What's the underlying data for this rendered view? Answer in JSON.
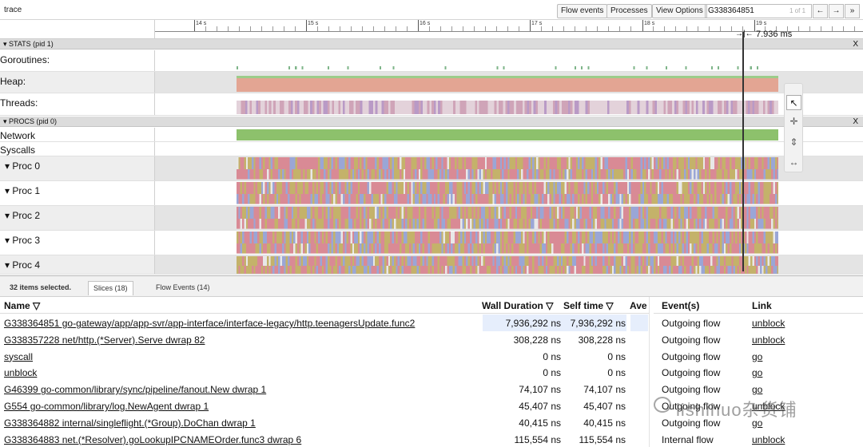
{
  "app": {
    "title": "trace",
    "buttons": {
      "flow_events": "Flow events",
      "processes": "Processes",
      "view_options": "View Options"
    },
    "search": {
      "value": "G338364851",
      "count": "1 of 1"
    },
    "nav": {
      "prev": "←",
      "next": "→",
      "expand": "»"
    }
  },
  "ruler": {
    "ticks": [
      "14 s",
      "15 s",
      "16 s",
      "17 s",
      "18 s",
      "19 s"
    ],
    "selection_duration": "7.936 ms"
  },
  "groups": {
    "stats": {
      "label": "▾ STATS (pid 1)",
      "close": "X"
    },
    "procs": {
      "label": "▾ PROCS (pid 0)",
      "close": "X"
    }
  },
  "tracks": {
    "goroutines": "Goroutines:",
    "heap": "Heap:",
    "threads": "Threads:",
    "network": "Network",
    "syscalls": "Syscalls",
    "proc0": "▾ Proc 0",
    "proc1": "▾ Proc 1",
    "proc2": "▾ Proc 2",
    "proc3": "▾ Proc 3",
    "proc4": "▾ Proc 4"
  },
  "colors": {
    "heap": "#e3a593",
    "heap_top": "#9ccc8a",
    "network": "#8dc16c",
    "proc_red": "#d98a95",
    "proc_blue": "#9aa6d6",
    "proc_olive": "#c4b26a",
    "threads": "#cfa4b8"
  },
  "tools": [
    "cursor-icon",
    "move-icon",
    "zoom-icon",
    "fit-width-icon"
  ],
  "panel": {
    "selected_count": "32 items selected.",
    "tabs": [
      "Slices (18)",
      "Flow Events (14)"
    ],
    "headers": {
      "name": "Name ▽",
      "wall": "Wall Duration ▽",
      "self": "Self time ▽",
      "ave": "Ave",
      "events": "Event(s)",
      "link": "Link"
    },
    "rows": [
      {
        "name": "G338364851 go-gateway/app/app-svr/app-interface/interface-legacy/http.teenagersUpdate.func2",
        "wall": "7,936,292 ns",
        "self": "7,936,292 ns",
        "event": "Outgoing flow",
        "link": "unblock"
      },
      {
        "name": "G338357228 net/http.(*Server).Serve       dwrap       82",
        "wall": "308,228 ns",
        "self": "308,228 ns",
        "event": "Outgoing flow",
        "link": "unblock"
      },
      {
        "name": "syscall",
        "wall": "0 ns",
        "self": "0 ns",
        "event": "Outgoing flow",
        "link": "go"
      },
      {
        "name": "unblock",
        "wall": "0 ns",
        "self": "0 ns",
        "event": "Outgoing flow",
        "link": "go"
      },
      {
        "name": "G46399 go-common/library/sync/pipeline/fanout.New       dwrap       1",
        "wall": "74,107 ns",
        "self": "74,107 ns",
        "event": "Outgoing flow",
        "link": "go"
      },
      {
        "name": "G554 go-common/library/log.NewAgent       dwrap       1",
        "wall": "45,407 ns",
        "self": "45,407 ns",
        "event": "Outgoing flow",
        "link": "unblock"
      },
      {
        "name": "G338364882 internal/singleflight.(*Group).DoChan       dwrap       1",
        "wall": "40,415 ns",
        "self": "40,415 ns",
        "event": "Outgoing flow",
        "link": "go"
      },
      {
        "name": "G338364883 net.(*Resolver).goLookupIPCNAMEOrder.func3       dwrap       6",
        "wall": "115,554 ns",
        "self": "115,554 ns",
        "event": "Internal flow",
        "link": "unblock"
      }
    ]
  },
  "watermark": "lishihuo杂货铺"
}
